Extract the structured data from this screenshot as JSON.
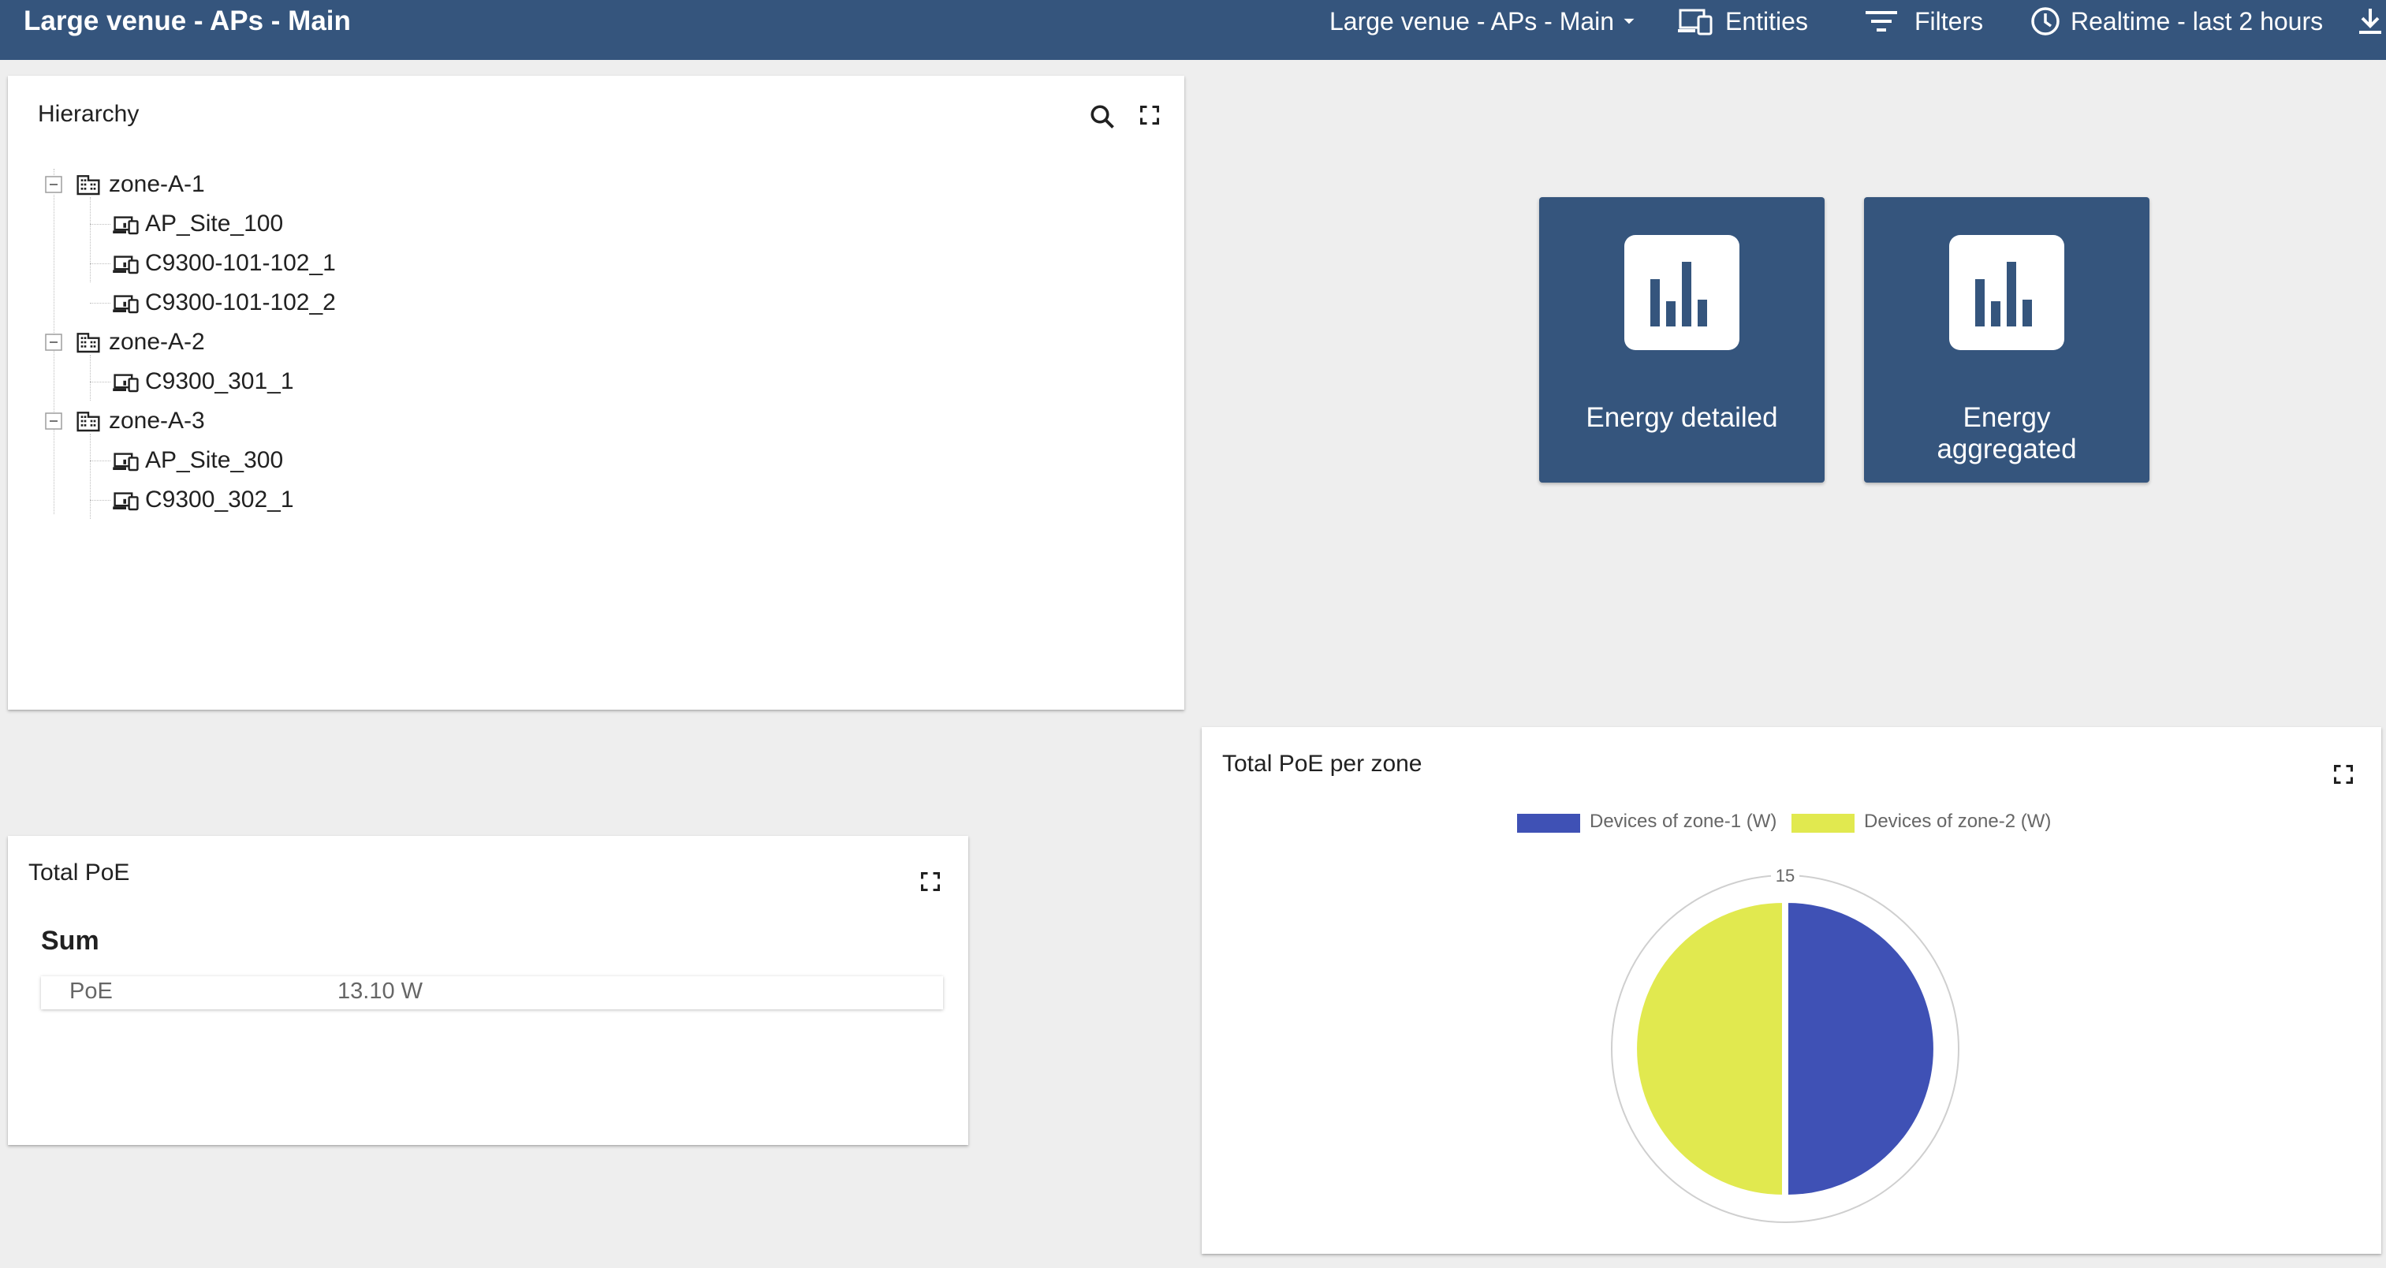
{
  "header": {
    "title": "Large venue - APs - Main",
    "dashboard_select": "Large venue - APs - Main",
    "entities_label": "Entities",
    "filters_label": "Filters",
    "timewindow_label": "Realtime - last 2 hours"
  },
  "hierarchy": {
    "title": "Hierarchy",
    "nodes": [
      {
        "label": "zone-A-1",
        "type": "zone",
        "expanded": true,
        "children": [
          "AP_Site_100",
          "C9300-101-102_1",
          "C9300-101-102_2"
        ]
      },
      {
        "label": "zone-A-2",
        "type": "zone",
        "expanded": true,
        "children": [
          "C9300_301_1"
        ]
      },
      {
        "label": "zone-A-3",
        "type": "zone",
        "expanded": true,
        "children": [
          "AP_Site_300",
          "C9300_302_1"
        ]
      }
    ]
  },
  "tiles": [
    {
      "label_line1": "Energy detailed",
      "label_line2": ""
    },
    {
      "label_line1": "Energy",
      "label_line2": "aggregated"
    }
  ],
  "total_poe": {
    "title": "Total PoE",
    "sum_heading": "Sum",
    "rows": [
      {
        "key": "PoE",
        "value": "13.10 W"
      }
    ]
  },
  "chart_data": {
    "type": "pie",
    "title": "Total PoE per zone",
    "scale_label": "15",
    "series": [
      {
        "name": "Devices of zone-1 (W)",
        "value": 6.55,
        "color": "#3f51b5"
      },
      {
        "name": "Devices of zone-2 (W)",
        "value": 6.55,
        "color": "#e1e94f"
      }
    ],
    "legend_position": "top"
  },
  "colors": {
    "accent": "#35557d",
    "background": "#eeeeee"
  }
}
